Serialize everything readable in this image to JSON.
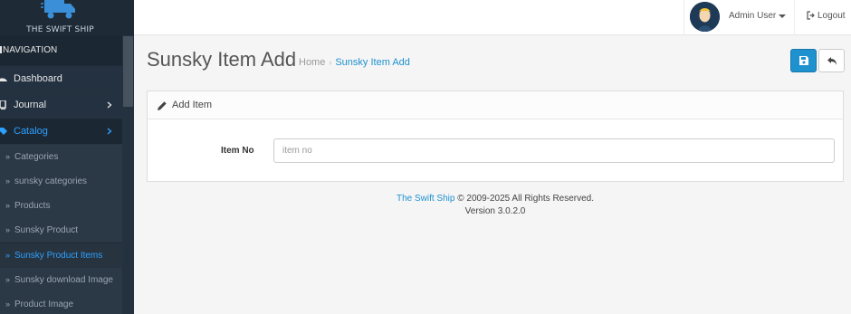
{
  "brand": {
    "name": "THE SWIFT SHIP"
  },
  "header": {
    "user_name": "Admin User",
    "logout_label": "Logout"
  },
  "sidebar": {
    "heading": "NAVIGATION",
    "items": [
      {
        "label": "Dashboard",
        "icon": "dashboard-icon"
      },
      {
        "label": "Journal",
        "icon": "tv-icon"
      },
      {
        "label": "Catalog",
        "icon": "tag-icon",
        "active": true
      }
    ],
    "sub_items": [
      {
        "label": "Categories"
      },
      {
        "label": "sunsky categories"
      },
      {
        "label": "Products"
      },
      {
        "label": "Sunsky Product"
      },
      {
        "label": "Sunsky Product Items",
        "active": true
      },
      {
        "label": "Sunsky download Image"
      },
      {
        "label": "Product Image"
      }
    ]
  },
  "page": {
    "title": "Sunsky Item Add",
    "breadcrumb": {
      "home": "Home",
      "separator": "›",
      "current": "Sunsky Item Add"
    }
  },
  "panel": {
    "title": "Add Item",
    "field_label": "Item No",
    "field_placeholder": "item no",
    "field_value": ""
  },
  "footer": {
    "link": "The Swift Ship",
    "copyright": "© 2009-2025 All Rights Reserved.",
    "version": "Version 3.0.2.0"
  },
  "colors": {
    "accent": "#1e91cf",
    "sidebar_bg": "#1e2b37",
    "active_text": "#2ea0ff"
  }
}
